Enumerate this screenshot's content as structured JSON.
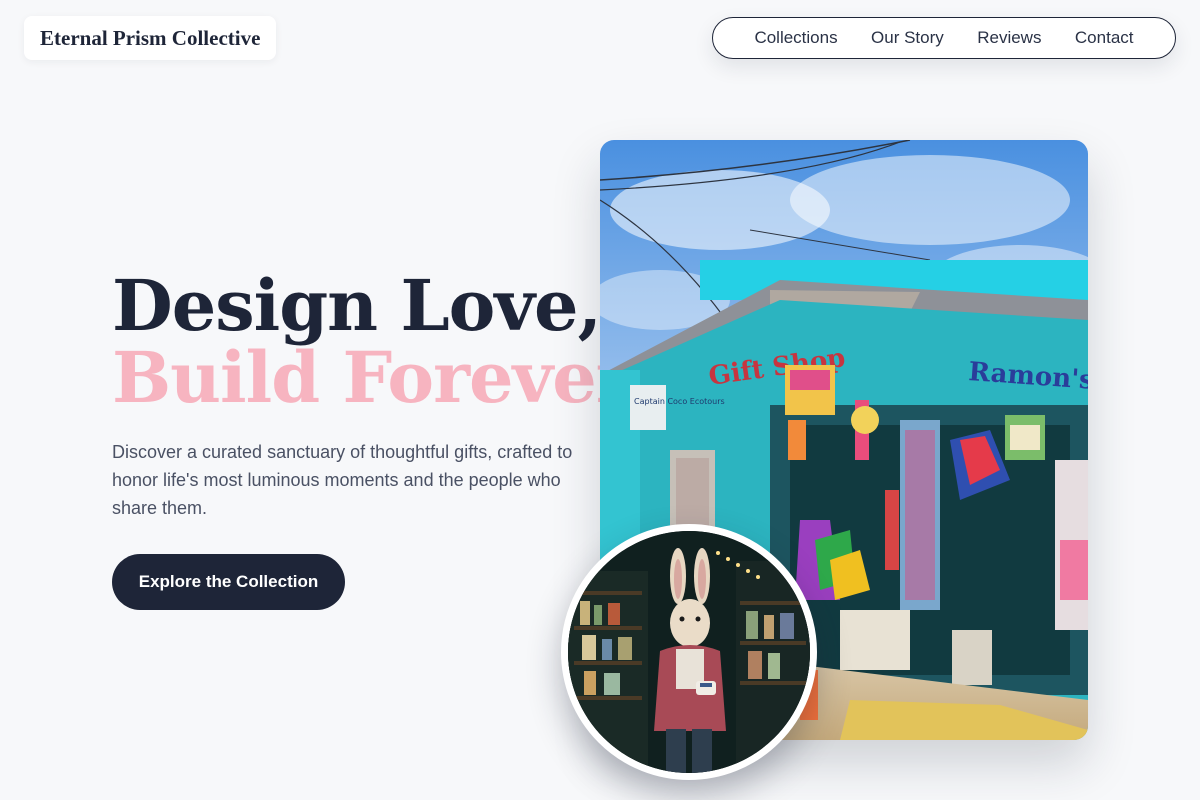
{
  "brand": {
    "name": "Eternal Prism Collective"
  },
  "nav": {
    "items": [
      {
        "label": "Collections"
      },
      {
        "label": "Our Story"
      },
      {
        "label": "Reviews"
      },
      {
        "label": "Contact"
      }
    ]
  },
  "hero": {
    "title_line1": "Design Love,",
    "title_line2": "Build Forever.",
    "description": "Discover a curated sanctuary of thoughtful gifts, crafted to honor life's most luminous moments and the people who share them.",
    "cta_label": "Explore the Collection"
  },
  "main_image": {
    "sign_gift": "Gift Shop",
    "sign_ramon": "Ramon's",
    "sign_small": "Captain Coco Ecotours"
  },
  "colors": {
    "navy": "#1e2538",
    "pink": "#f7b4c0",
    "background": "#f7f8fa",
    "shop_teal": "#27b6c3"
  },
  "icons": {
    "main_image": "gift-shop-photo",
    "inset_image": "rabbit-figure-photo"
  }
}
